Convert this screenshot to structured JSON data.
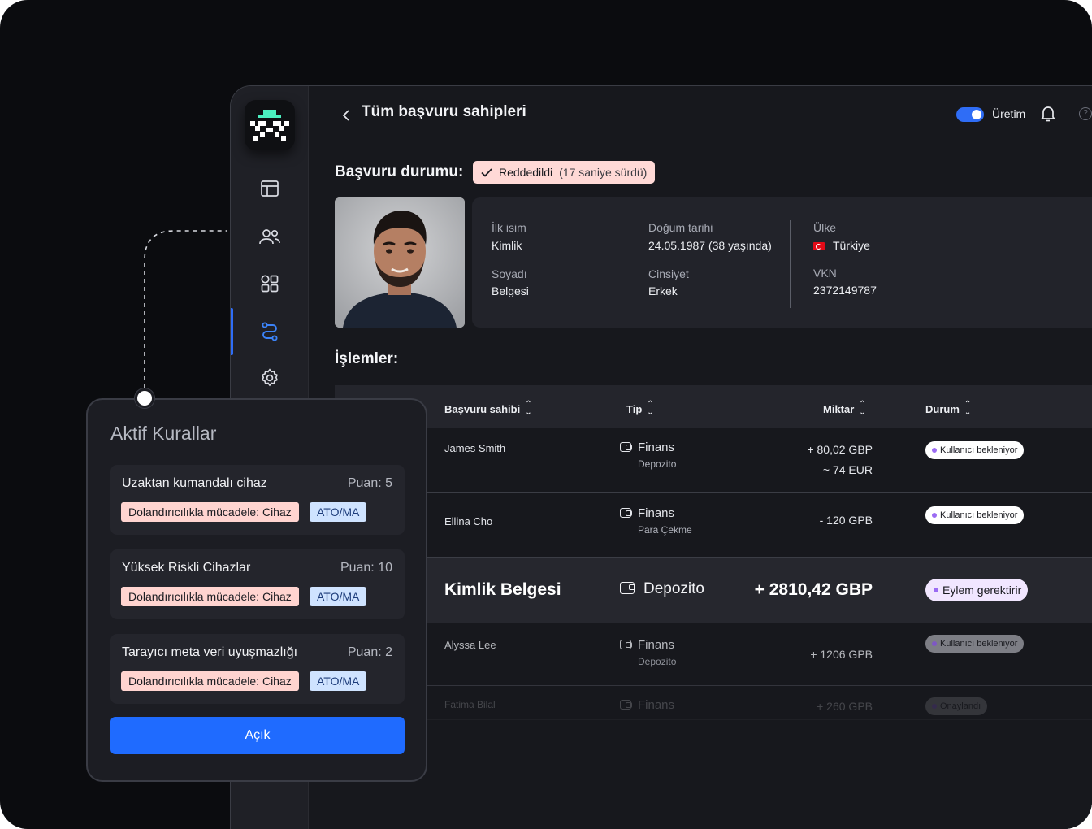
{
  "header": {
    "back_label": "Tüm başvuru sahipleri",
    "environment_label": "Üretim",
    "help_glyph": "?"
  },
  "status": {
    "label": "Başvuru durumu:",
    "badge_text": "Reddedildi",
    "badge_detail": "(17 saniye sürdü)"
  },
  "applicant": {
    "first_name_label": "İlk isim",
    "first_name": "Kimlik",
    "last_name_label": "Soyadı",
    "last_name": "Belgesi",
    "dob_label": "Doğum tarihi",
    "dob": "24.05.1987 (38 yaşında)",
    "gender_label": "Cinsiyet",
    "gender": "Erkek",
    "country_label": "Ülke",
    "country": "Türkiye",
    "tax_label": "VKN",
    "tax_id": "2372149787"
  },
  "transactions": {
    "title": "İşlemler:",
    "columns": [
      "Başvuru sahibi",
      "Tip",
      "Miktar",
      "Durum"
    ],
    "rows": [
      {
        "applicant": "James Smith",
        "type": "Finans",
        "subtype": "Depozito",
        "amount": "+ 80,02 GBP",
        "amount_alt": "~ 74 EUR",
        "status": "Kullanıcı bekleniyor"
      },
      {
        "applicant": "Ellina Cho",
        "type": "Finans",
        "subtype": "Para Çekme",
        "amount": "- 120 GPB",
        "status": "Kullanıcı bekleniyor"
      },
      {
        "applicant": "Kimlik Belgesi",
        "type": "Depozito",
        "amount": "+ 2810,42 GBP",
        "status": "Eylem gerektirir"
      },
      {
        "applicant": "Alyssa Lee",
        "type": "Finans",
        "subtype": "Depozito",
        "amount": "+ 1206 GPB",
        "status": "Kullanıcı bekleniyor"
      },
      {
        "applicant": "Fatima Bilal",
        "type": "Finans",
        "amount": "+ 260 GPB",
        "status": "Onaylandı"
      }
    ]
  },
  "rules": {
    "title": "Aktif Kurallar",
    "items": [
      {
        "name": "Uzaktan kumandalı cihaz",
        "score": "Puan: 5",
        "tag_category": "Dolandırıcılıkla mücadele: Cihaz",
        "tag_type": "ATO/MA"
      },
      {
        "name": "Yüksek Riskli Cihazlar",
        "score": "Puan: 10",
        "tag_category": "Dolandırıcılıkla mücadele: Cihaz",
        "tag_type": "ATO/MA"
      },
      {
        "name": "Tarayıcı meta veri uyuşmazlığı",
        "score": "Puan: 2",
        "tag_category": "Dolandırıcılıkla mücadele: Cihaz",
        "tag_type": "ATO/MA"
      }
    ],
    "button_label": "Açık"
  },
  "colors": {
    "accent": "#1f6bff",
    "reject_badge": "#ffd9d6",
    "tag_red": "#ffd4d0",
    "tag_blue": "#cfe3ff",
    "status_dot": "#9b6bf3"
  },
  "icons": [
    "logo-icon",
    "layout-icon",
    "users-icon",
    "apps-icon",
    "flow-icon",
    "gear-icon",
    "back-chevron-icon",
    "bell-icon",
    "check-icon",
    "wallet-icon",
    "sort-icon"
  ]
}
